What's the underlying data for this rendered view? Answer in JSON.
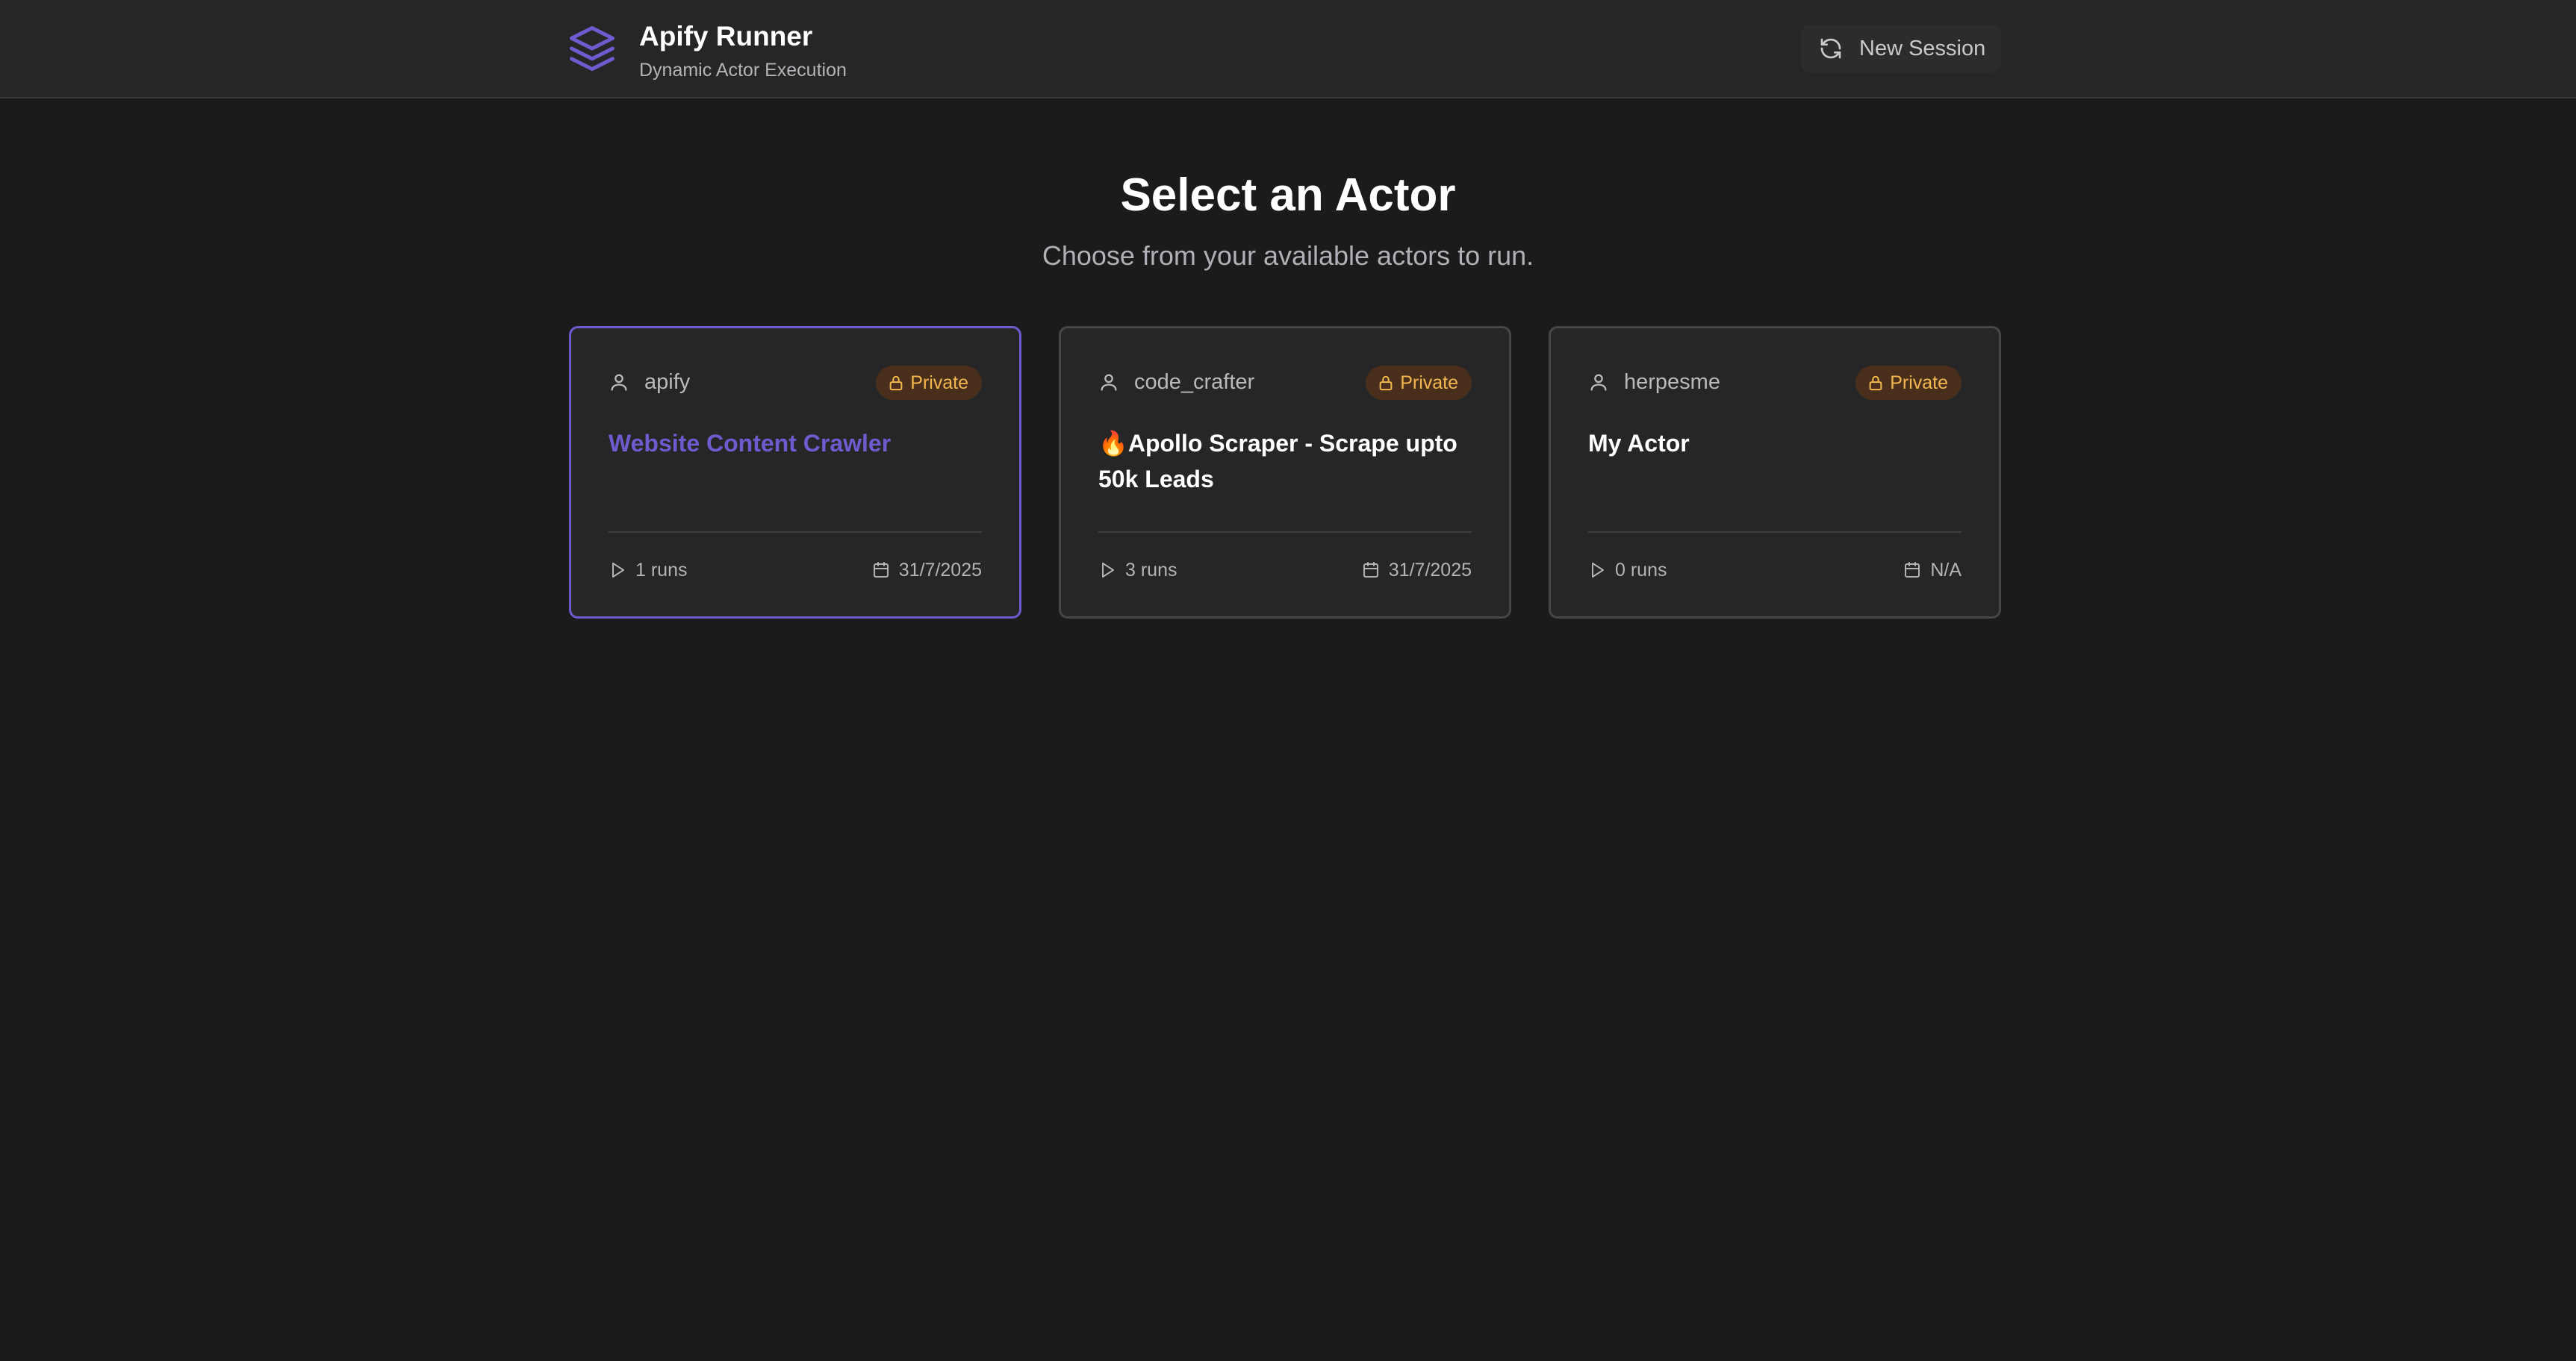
{
  "header": {
    "title": "Apify Runner",
    "subtitle": "Dynamic Actor Execution",
    "logo_icon": "layers-icon",
    "new_session_label": "New Session",
    "new_session_icon": "refresh-icon"
  },
  "main": {
    "heading": "Select an Actor",
    "subheading": "Choose from your available actors to run."
  },
  "actors": [
    {
      "owner": "apify",
      "visibility": "Private",
      "title": "Website Content Crawler",
      "runs": "1 runs",
      "date": "31/7/2025",
      "selected": true
    },
    {
      "owner": "code_crafter",
      "visibility": "Private",
      "title": "🔥Apollo Scraper - Scrape upto 50k Leads",
      "runs": "3 runs",
      "date": "31/7/2025",
      "selected": false
    },
    {
      "owner": "herpesme",
      "visibility": "Private",
      "title": "My Actor",
      "runs": "0 runs",
      "date": "N/A",
      "selected": false
    }
  ],
  "colors": {
    "accent": "#6e5bd0",
    "background": "#1b1b1b",
    "card": "#262626",
    "badge_bg": "#4a2e1c",
    "badge_text": "#f2b750"
  }
}
